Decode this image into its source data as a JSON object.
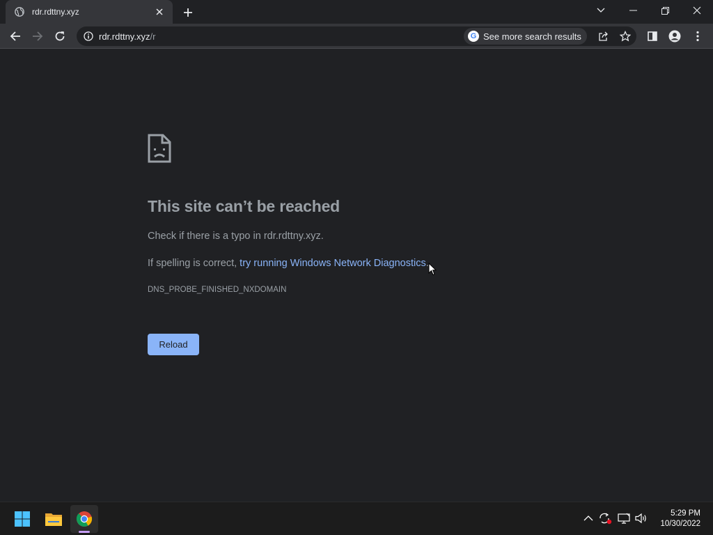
{
  "tab": {
    "title": "rdr.rdttny.xyz"
  },
  "omnibox": {
    "url_host": "rdr.rdttny.xyz",
    "url_path": "/r",
    "chip_label": "See more search results"
  },
  "error": {
    "heading": "This site can’t be reached",
    "line1": "Check if there is a typo in rdr.rdttny.xyz.",
    "line2_prefix": "If spelling is correct, ",
    "line2_link": "try running Windows Network Diagnostics",
    "line2_suffix": ".",
    "code": "DNS_PROBE_FINISHED_NXDOMAIN",
    "reload_label": "Reload"
  },
  "taskbar": {
    "time": "5:29 PM",
    "date": "10/30/2022"
  },
  "colors": {
    "link": "#8ab4f8",
    "text_dim": "#9aa0a6",
    "bg": "#202124",
    "toolbar": "#35363a"
  },
  "icons": [
    "globe-icon",
    "close-icon",
    "plus-icon",
    "chevron-down-icon",
    "minimize-icon",
    "restore-icon",
    "window-close-icon",
    "back-icon",
    "forward-icon",
    "reload-icon",
    "info-icon",
    "google-icon",
    "share-icon",
    "star-icon",
    "side-panel-icon",
    "profile-icon",
    "menu-icon",
    "sad-page-icon",
    "windows-start-icon",
    "file-explorer-icon",
    "chrome-icon",
    "chevron-up-icon",
    "sync-icon",
    "network-icon",
    "volume-icon"
  ]
}
